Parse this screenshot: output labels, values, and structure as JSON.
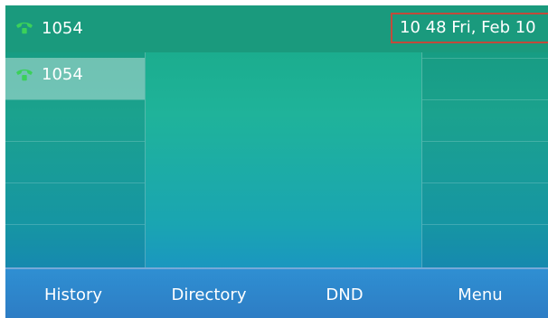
{
  "status_bar": {
    "account": "1054",
    "datetime": "10 48 Fri, Feb 10",
    "icon": "phone-registered-icon"
  },
  "lines": [
    {
      "label": "1054",
      "icon": "phone-registered-icon",
      "selected": true
    }
  ],
  "softkeys": [
    {
      "label": "History"
    },
    {
      "label": "Directory"
    },
    {
      "label": "DND"
    },
    {
      "label": "Menu"
    }
  ],
  "colors": {
    "topbar": "#1a9a7d",
    "registered_icon": "#3bd15a",
    "highlight_border": "#c14a3b",
    "softkey_bar": "#2d7cc4"
  }
}
